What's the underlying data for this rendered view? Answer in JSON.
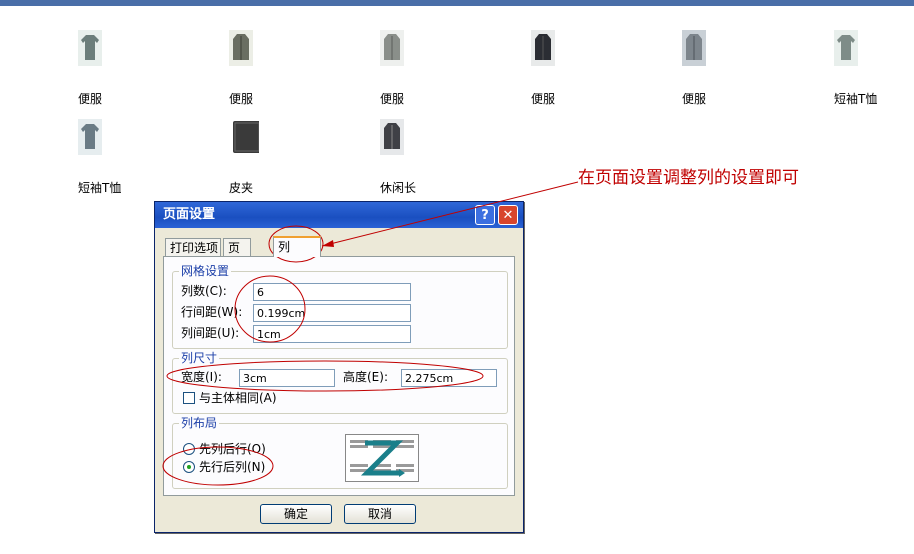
{
  "products": [
    {
      "label": "便服",
      "color": "#6b7d7a"
    },
    {
      "label": "便服",
      "color": "#6a6e62"
    },
    {
      "label": "便服",
      "color": "#8a8f8a"
    },
    {
      "label": "便服",
      "color": "#2b2d33"
    },
    {
      "label": "便服",
      "color": "#7d858c"
    },
    {
      "label": "短袖T恤",
      "color": "#7e8c88"
    },
    {
      "label": "短袖T恤",
      "color": "#6a7b85"
    },
    {
      "label": "皮夹",
      "color": "#3a3a3a"
    },
    {
      "label": "休闲长",
      "color": "#3f4046"
    }
  ],
  "annotation": {
    "text": "在页面设置调整列的设置即可",
    "color": "#c00000"
  },
  "dialog": {
    "title": "页面设置",
    "help_label": "?",
    "close_label": "✕",
    "tabs": [
      "打印选项",
      "页",
      "列"
    ],
    "grid": {
      "title": "网格设置",
      "columns_label": "列数(C):",
      "columns_value": "6",
      "row_spacing_label": "行间距(W):",
      "row_spacing_value": "0.199cm",
      "col_spacing_label": "列间距(U):",
      "col_spacing_value": "1cm"
    },
    "size": {
      "title": "列尺寸",
      "width_label": "宽度(I):",
      "width_value": "3cm",
      "height_label": "高度(E):",
      "height_value": "2.275cm",
      "same_label": "与主体相同(A)",
      "same_checked": false
    },
    "layout": {
      "title": "列布局",
      "option1": "先列后行(O)",
      "option2": "先行后列(N)",
      "selected": "option2"
    },
    "ok_label": "确定",
    "cancel_label": "取消"
  }
}
